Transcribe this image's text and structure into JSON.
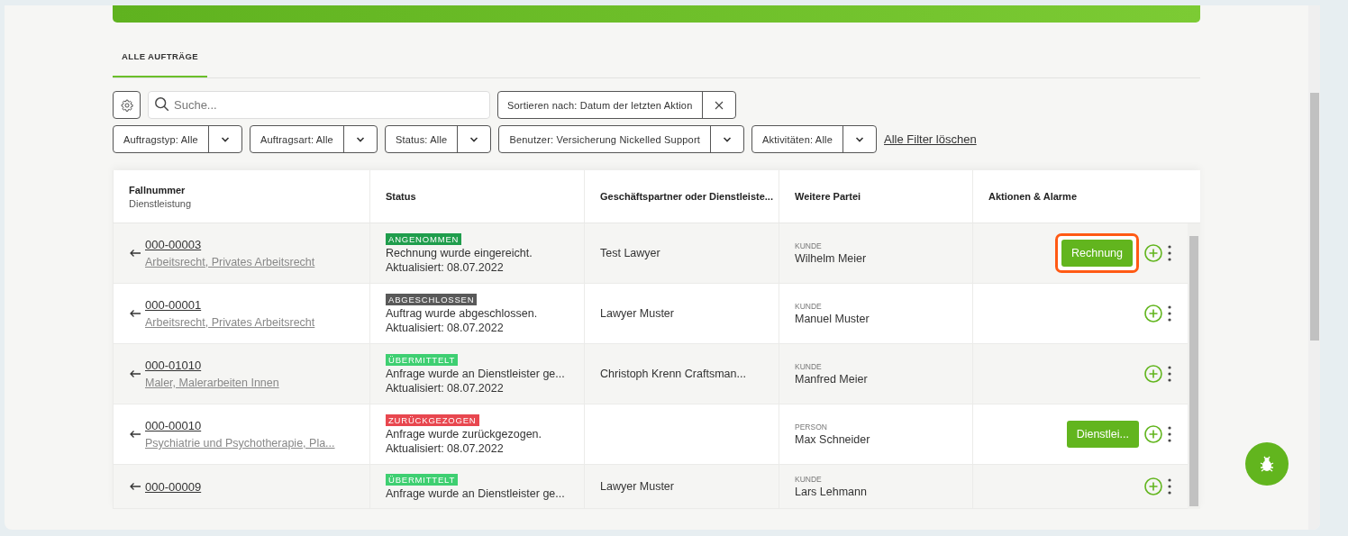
{
  "tabs": [
    {
      "label": "ALLE AUFTRÄGE",
      "selected": true
    }
  ],
  "search": {
    "placeholder": "Suche..."
  },
  "sort": {
    "label": "Sortieren nach: Datum der letzten Aktion"
  },
  "filters": [
    {
      "label": "Auftragstyp: Alle"
    },
    {
      "label": "Auftragsart: Alle"
    },
    {
      "label": "Status: Alle"
    },
    {
      "label": "Benutzer: Versicherung Nickelled Support"
    },
    {
      "label": "Aktivitäten: Alle"
    }
  ],
  "clear_filters": "Alle Filter löschen",
  "table": {
    "columns": [
      {
        "label": "Fallnummer",
        "sublabel": "Dienstleistung"
      },
      {
        "label": "Status"
      },
      {
        "label": "Geschäftspartner oder Dienstleiste..."
      },
      {
        "label": "Weitere Partei"
      },
      {
        "label": "Aktionen & Alarme"
      }
    ],
    "rows": [
      {
        "case": "000-00003",
        "service": "Arbeitsrecht, Privates Arbeitsrecht",
        "badge": "ANGENOMMEN",
        "color": "#1f9d4c",
        "message": "Rechnung wurde eingereicht.",
        "updated": "Aktualisiert: 08.07.2022",
        "partner": "Test Lawyer",
        "role": "KUNDE",
        "party": "Wilhelm Meier",
        "action": {
          "label": "Rechnung",
          "highlighted": true
        }
      },
      {
        "case": "000-00001",
        "service": "Arbeitsrecht, Privates Arbeitsrecht",
        "badge": "ABGESCHLOSSEN",
        "color": "#595959",
        "message": "Auftrag wurde abgeschlossen.",
        "updated": "Aktualisiert: 08.07.2022",
        "partner": "Lawyer Muster",
        "role": "KUNDE",
        "party": "Manuel Muster"
      },
      {
        "case": "000-01010",
        "service": "Maler, Malerarbeiten Innen",
        "badge": "ÜBERMITTELT",
        "color": "#3ecf71",
        "message": "Anfrage wurde an Dienstleister ge...",
        "updated": "Aktualisiert: 08.07.2022",
        "partner": "Christoph Krenn Craftsman...",
        "role": "KUNDE",
        "party": "Manfred Meier"
      },
      {
        "case": "000-00010",
        "service": "Psychiatrie und Psychotherapie, Pla...",
        "badge": "ZURÜCKGEZOGEN",
        "color": "#e8474f",
        "message": "Anfrage wurde zurückgezogen.",
        "updated": "Aktualisiert: 08.07.2022",
        "role": "PERSON",
        "party": "Max Schneider",
        "action": {
          "label": "Dienstlei...",
          "highlighted": false
        }
      },
      {
        "case": "000-00009",
        "badge": "ÜBERMITTELT",
        "color": "#3ecf71",
        "message": "Anfrage wurde an Dienstleister ge...",
        "partner": "Lawyer Muster",
        "role": "KUNDE",
        "party": "Lars Lehmann"
      }
    ]
  }
}
